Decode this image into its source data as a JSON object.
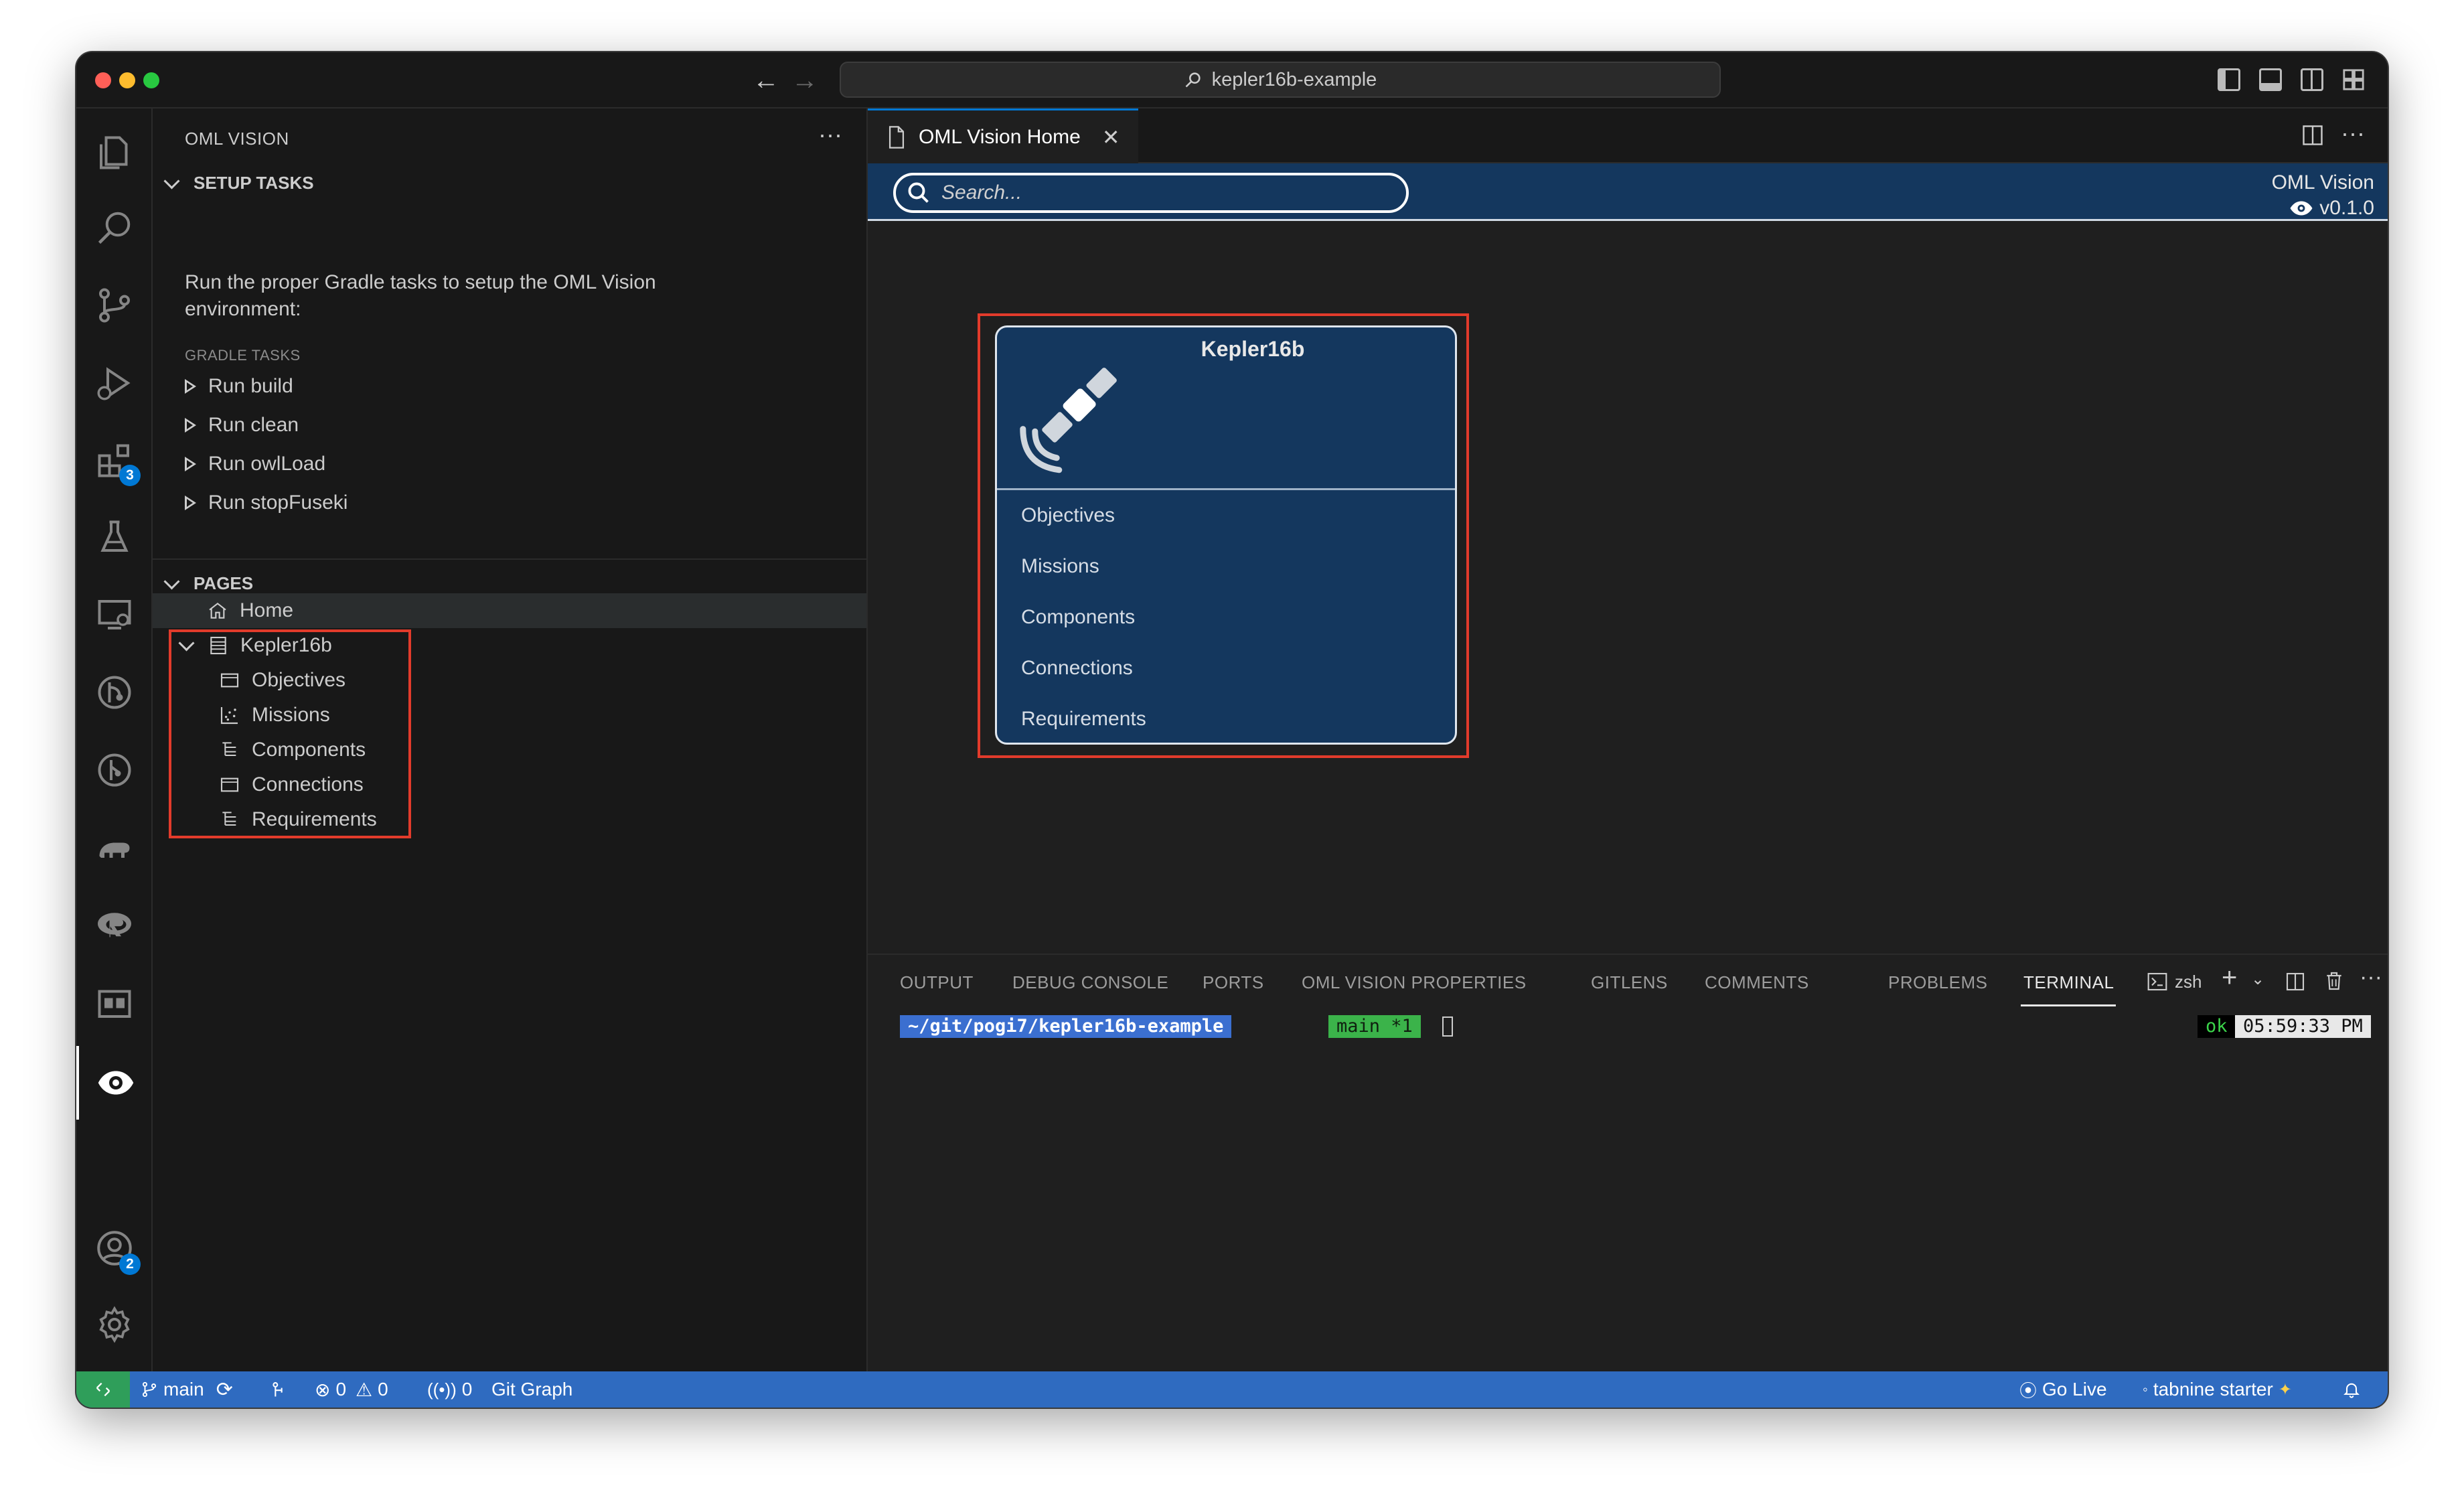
{
  "window": {
    "title": "kepler16b-example"
  },
  "sidebar": {
    "title": "OML VISION",
    "setup": {
      "header": "SETUP TASKS",
      "description": "Run the proper Gradle tasks to setup the OML Vision environment:",
      "gradle_label": "GRADLE TASKS",
      "tasks": [
        "Run build",
        "Run clean",
        "Run owlLoad",
        "Run stopFuseki"
      ]
    },
    "pages": {
      "header": "PAGES",
      "home": "Home",
      "group": "Kepler16b",
      "children": [
        "Objectives",
        "Missions",
        "Components",
        "Connections",
        "Requirements"
      ]
    }
  },
  "activity_badges": {
    "extensions": "3",
    "accounts": "2"
  },
  "editor": {
    "tab_label": "OML Vision Home",
    "search_placeholder": "Search...",
    "brand_name": "OML Vision",
    "brand_version": "v0.1.0",
    "card": {
      "title": "Kepler16b",
      "items": [
        "Objectives",
        "Missions",
        "Components",
        "Connections",
        "Requirements"
      ]
    }
  },
  "panel": {
    "tabs": [
      "OUTPUT",
      "DEBUG CONSOLE",
      "PORTS",
      "OML VISION PROPERTIES",
      "GITLENS",
      "COMMENTS",
      "PROBLEMS",
      "TERMINAL"
    ],
    "active_tab": "TERMINAL",
    "shell": "zsh",
    "prompt_path": "~/git/pogi7/kepler16b-example",
    "prompt_branch": "main *1",
    "status_ok": "ok",
    "time": "05:59:33 PM"
  },
  "statusbar": {
    "branch": "main",
    "errors": "0",
    "warnings": "0",
    "ports": "0",
    "git_graph": "Git Graph",
    "go_live": "Go Live",
    "tabnine": "tabnine starter"
  },
  "colors": {
    "accent": "#0078d4",
    "status_bar": "#2f6bc0",
    "webview_navy": "#14375e",
    "highlight_red": "#e23b2b"
  }
}
